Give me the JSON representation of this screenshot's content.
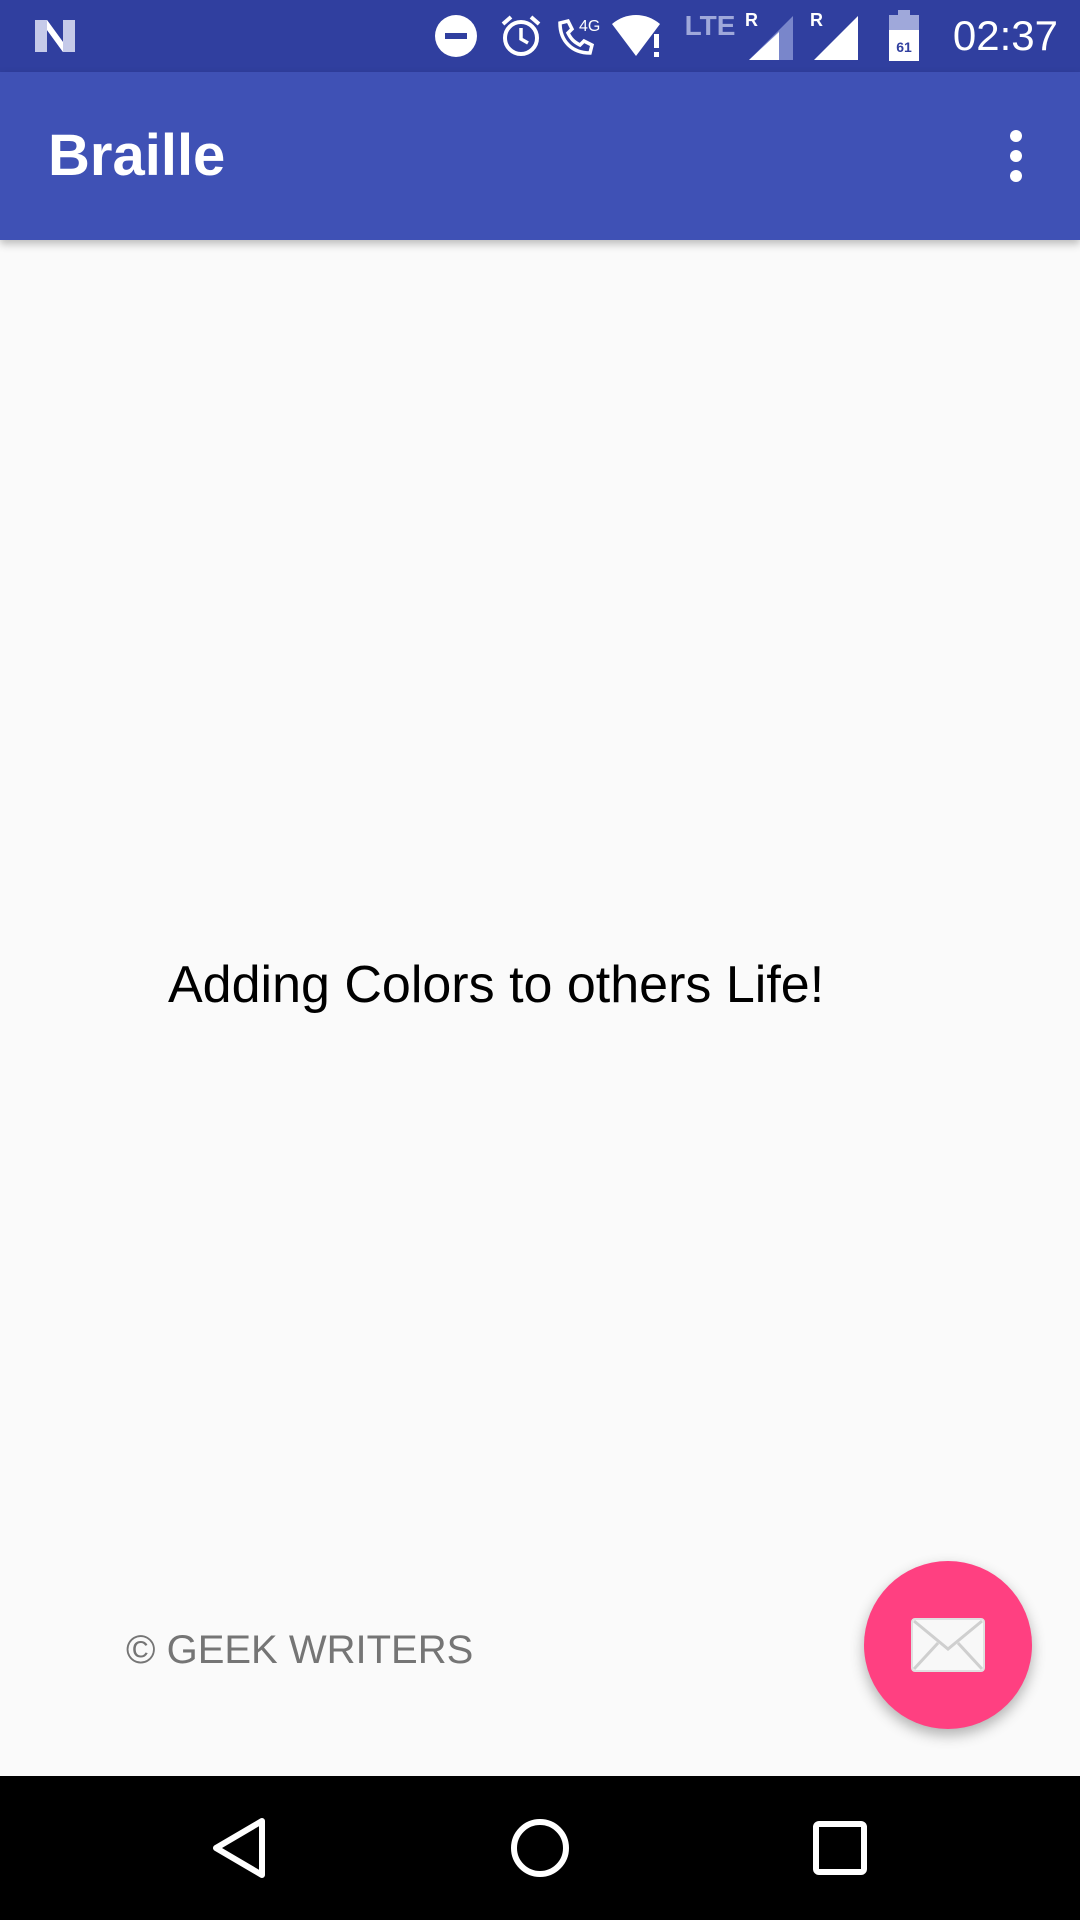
{
  "status_bar": {
    "time": "02:37",
    "network_label": "4G",
    "lte_label": "LTE",
    "roaming_1": "R",
    "roaming_2": "R",
    "battery_level": "61",
    "icons": [
      "notification-n-icon",
      "do-not-disturb-icon",
      "alarm-icon",
      "wifi-calling-icon",
      "wifi-icon",
      "signal-icon",
      "signal-icon",
      "battery-icon"
    ],
    "background_color": "#303f9f"
  },
  "app_bar": {
    "title": "Braille",
    "menu_icon": "more-vert-icon",
    "background_color": "#3f51b5"
  },
  "main": {
    "tagline": "Adding Colors to others Life!",
    "copyright": "© GEEK WRITERS"
  },
  "fab": {
    "icon": "mail-icon",
    "color": "#ff4081"
  },
  "nav_bar": {
    "back_icon": "back-icon",
    "home_icon": "home-icon",
    "recents_icon": "recents-icon"
  }
}
